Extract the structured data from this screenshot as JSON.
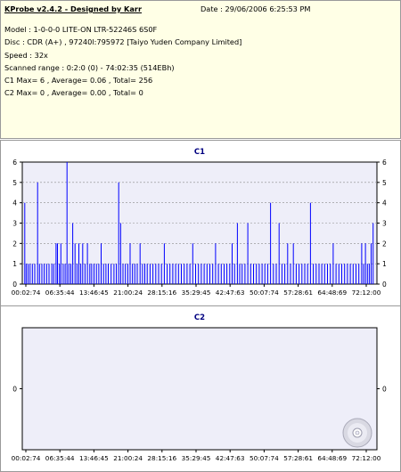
{
  "info": {
    "title": "KProbe v2.4.2 - Designed by Karr",
    "date": "Date : 29/06/2006 6:25:53 PM",
    "model": "Model : 1-0-0-0 LITE-ON LTR-52246S        6S0F",
    "disc": "Disc : CDR (A+) , 97240l:795972 [Taiyo Yuden Company Limited]",
    "speed": "Speed : 32x",
    "scanned_range": "Scanned range : 0:2:0 (0) - 74:02:35 (514EBh)",
    "c1_stats": "C1 Max= 6 , Average= 0.06 , Total= 256",
    "c2_stats": "C2 Max= 0 , Average= 0.00 , Total= 0"
  },
  "colors": {
    "plot_background": "#eeeef9",
    "bar_color": "#0000ff",
    "title_color": "#000080",
    "grid_color": "#8a8a8a"
  },
  "chart_data": [
    {
      "type": "bar",
      "title": "C1",
      "x_tick_labels": [
        "00:02:74",
        "06:35:44",
        "13:46:45",
        "21:00:24",
        "28:15:16",
        "35:29:45",
        "42:47:63",
        "50:07:74",
        "57:28:61",
        "64:48:69",
        "72:12:00"
      ],
      "ylim": [
        0,
        6
      ],
      "y_ticks": [
        "0",
        "1",
        "2",
        "3",
        "4",
        "5",
        "6"
      ],
      "grid": true,
      "x_range_minutes": [
        0.05,
        74.04
      ],
      "bars": [
        {
          "t": 0.2,
          "v": 4
        },
        {
          "t": 0.5,
          "v": 1
        },
        {
          "t": 0.9,
          "v": 1
        },
        {
          "t": 1.3,
          "v": 1
        },
        {
          "t": 1.8,
          "v": 1
        },
        {
          "t": 2.3,
          "v": 1
        },
        {
          "t": 2.9,
          "v": 5
        },
        {
          "t": 3.3,
          "v": 1
        },
        {
          "t": 3.8,
          "v": 1
        },
        {
          "t": 4.3,
          "v": 1
        },
        {
          "t": 4.8,
          "v": 1
        },
        {
          "t": 5.3,
          "v": 1
        },
        {
          "t": 5.9,
          "v": 1
        },
        {
          "t": 6.3,
          "v": 1
        },
        {
          "t": 6.8,
          "v": 2
        },
        {
          "t": 7.1,
          "v": 2
        },
        {
          "t": 7.5,
          "v": 1
        },
        {
          "t": 7.8,
          "v": 2
        },
        {
          "t": 8.3,
          "v": 1
        },
        {
          "t": 8.7,
          "v": 1
        },
        {
          "t": 9.1,
          "v": 6
        },
        {
          "t": 9.5,
          "v": 1
        },
        {
          "t": 9.9,
          "v": 1
        },
        {
          "t": 10.3,
          "v": 3
        },
        {
          "t": 10.8,
          "v": 2
        },
        {
          "t": 11.2,
          "v": 1
        },
        {
          "t": 11.6,
          "v": 2
        },
        {
          "t": 12.0,
          "v": 1
        },
        {
          "t": 12.4,
          "v": 2
        },
        {
          "t": 12.9,
          "v": 1
        },
        {
          "t": 13.4,
          "v": 2
        },
        {
          "t": 13.9,
          "v": 1
        },
        {
          "t": 14.3,
          "v": 1
        },
        {
          "t": 14.8,
          "v": 1
        },
        {
          "t": 15.3,
          "v": 1
        },
        {
          "t": 15.8,
          "v": 1
        },
        {
          "t": 16.3,
          "v": 2
        },
        {
          "t": 16.8,
          "v": 1
        },
        {
          "t": 17.3,
          "v": 1
        },
        {
          "t": 17.8,
          "v": 1
        },
        {
          "t": 18.4,
          "v": 1
        },
        {
          "t": 19.0,
          "v": 1
        },
        {
          "t": 19.5,
          "v": 1
        },
        {
          "t": 20.0,
          "v": 5
        },
        {
          "t": 20.4,
          "v": 3
        },
        {
          "t": 20.9,
          "v": 1
        },
        {
          "t": 21.4,
          "v": 1
        },
        {
          "t": 21.9,
          "v": 1
        },
        {
          "t": 22.4,
          "v": 2
        },
        {
          "t": 22.9,
          "v": 1
        },
        {
          "t": 23.4,
          "v": 1
        },
        {
          "t": 23.9,
          "v": 1
        },
        {
          "t": 24.5,
          "v": 2
        },
        {
          "t": 25.0,
          "v": 1
        },
        {
          "t": 25.5,
          "v": 1
        },
        {
          "t": 26.0,
          "v": 1
        },
        {
          "t": 26.6,
          "v": 1
        },
        {
          "t": 27.2,
          "v": 1
        },
        {
          "t": 27.8,
          "v": 1
        },
        {
          "t": 28.4,
          "v": 1
        },
        {
          "t": 29.0,
          "v": 1
        },
        {
          "t": 29.6,
          "v": 2
        },
        {
          "t": 30.2,
          "v": 1
        },
        {
          "t": 30.8,
          "v": 1
        },
        {
          "t": 31.4,
          "v": 1
        },
        {
          "t": 32.0,
          "v": 1
        },
        {
          "t": 32.6,
          "v": 1
        },
        {
          "t": 33.2,
          "v": 1
        },
        {
          "t": 33.8,
          "v": 1
        },
        {
          "t": 34.4,
          "v": 1
        },
        {
          "t": 35.0,
          "v": 1
        },
        {
          "t": 35.6,
          "v": 2
        },
        {
          "t": 36.2,
          "v": 1
        },
        {
          "t": 36.8,
          "v": 1
        },
        {
          "t": 37.4,
          "v": 1
        },
        {
          "t": 38.0,
          "v": 1
        },
        {
          "t": 38.6,
          "v": 1
        },
        {
          "t": 39.2,
          "v": 1
        },
        {
          "t": 39.8,
          "v": 1
        },
        {
          "t": 40.4,
          "v": 2
        },
        {
          "t": 41.0,
          "v": 1
        },
        {
          "t": 41.6,
          "v": 1
        },
        {
          "t": 42.2,
          "v": 1
        },
        {
          "t": 42.8,
          "v": 1
        },
        {
          "t": 43.4,
          "v": 1
        },
        {
          "t": 43.9,
          "v": 2
        },
        {
          "t": 44.4,
          "v": 1
        },
        {
          "t": 45.0,
          "v": 3
        },
        {
          "t": 45.5,
          "v": 1
        },
        {
          "t": 46.0,
          "v": 1
        },
        {
          "t": 46.6,
          "v": 1
        },
        {
          "t": 47.2,
          "v": 3
        },
        {
          "t": 47.8,
          "v": 1
        },
        {
          "t": 48.4,
          "v": 1
        },
        {
          "t": 49.0,
          "v": 1
        },
        {
          "t": 49.6,
          "v": 1
        },
        {
          "t": 50.2,
          "v": 1
        },
        {
          "t": 50.8,
          "v": 1
        },
        {
          "t": 51.4,
          "v": 1
        },
        {
          "t": 52.0,
          "v": 4
        },
        {
          "t": 52.6,
          "v": 1
        },
        {
          "t": 53.2,
          "v": 1
        },
        {
          "t": 53.8,
          "v": 3
        },
        {
          "t": 54.4,
          "v": 1
        },
        {
          "t": 55.0,
          "v": 1
        },
        {
          "t": 55.6,
          "v": 2
        },
        {
          "t": 56.2,
          "v": 1
        },
        {
          "t": 56.8,
          "v": 2
        },
        {
          "t": 57.4,
          "v": 1
        },
        {
          "t": 58.0,
          "v": 1
        },
        {
          "t": 58.6,
          "v": 1
        },
        {
          "t": 59.2,
          "v": 1
        },
        {
          "t": 59.8,
          "v": 1
        },
        {
          "t": 60.4,
          "v": 4
        },
        {
          "t": 61.0,
          "v": 1
        },
        {
          "t": 61.6,
          "v": 1
        },
        {
          "t": 62.2,
          "v": 1
        },
        {
          "t": 62.8,
          "v": 1
        },
        {
          "t": 63.4,
          "v": 1
        },
        {
          "t": 64.0,
          "v": 1
        },
        {
          "t": 64.6,
          "v": 1
        },
        {
          "t": 65.2,
          "v": 2
        },
        {
          "t": 65.8,
          "v": 1
        },
        {
          "t": 66.4,
          "v": 1
        },
        {
          "t": 67.0,
          "v": 1
        },
        {
          "t": 67.6,
          "v": 1
        },
        {
          "t": 68.2,
          "v": 1
        },
        {
          "t": 68.8,
          "v": 1
        },
        {
          "t": 69.4,
          "v": 1
        },
        {
          "t": 70.0,
          "v": 1
        },
        {
          "t": 70.6,
          "v": 1
        },
        {
          "t": 71.2,
          "v": 2
        },
        {
          "t": 71.6,
          "v": 1
        },
        {
          "t": 72.0,
          "v": 2
        },
        {
          "t": 72.4,
          "v": 1
        },
        {
          "t": 72.8,
          "v": 1
        },
        {
          "t": 73.2,
          "v": 2
        },
        {
          "t": 73.6,
          "v": 3
        }
      ]
    },
    {
      "type": "bar",
      "title": "C2",
      "x_tick_labels": [
        "00:02:74",
        "06:35:44",
        "13:46:45",
        "21:00:24",
        "28:15:16",
        "35:29:45",
        "42:47:63",
        "50:07:74",
        "57:28:61",
        "64:48:69",
        "72:12:00"
      ],
      "y_ticks": [
        "0"
      ],
      "grid": false,
      "bars": []
    }
  ]
}
